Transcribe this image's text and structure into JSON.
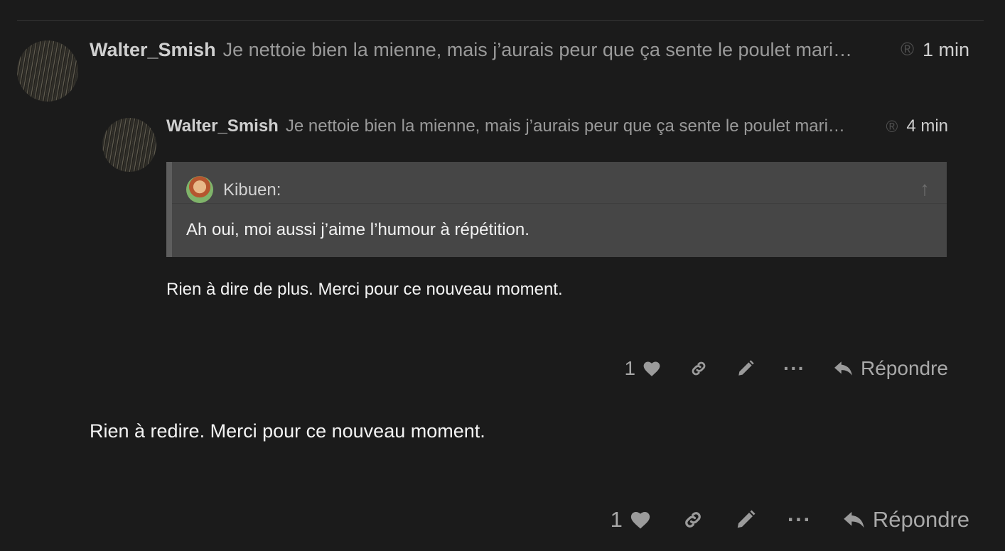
{
  "main_post": {
    "username": "Walter_Smish",
    "excerpt": "Je nettoie bien la mienne, mais j’aurais peur que ça sente le poulet mari…",
    "reg_icon": "registered-icon",
    "time": "1 min",
    "body": "Rien à redire. Merci pour ce nouveau moment.",
    "actions": {
      "like_count": "1",
      "reply_label": "Répondre"
    }
  },
  "nested_post": {
    "username": "Walter_Smish",
    "excerpt": "Je nettoie bien la mienne, mais j’aurais peur que ça sente le poulet mari…",
    "reg_icon": "registered-icon",
    "time": "4 min",
    "quote": {
      "username": "Kibuen:",
      "text": "Ah oui, moi aussi j’aime l’humour à répétition."
    },
    "body": "Rien à dire de plus. Merci pour ce nouveau moment.",
    "actions": {
      "like_count": "1",
      "reply_label": "Répondre"
    }
  },
  "icons": {
    "heart": "heart-icon",
    "link": "link-icon",
    "edit": "pencil-icon",
    "more": "ellipsis-icon",
    "reply": "reply-icon",
    "expand": "arrow-up-icon"
  }
}
